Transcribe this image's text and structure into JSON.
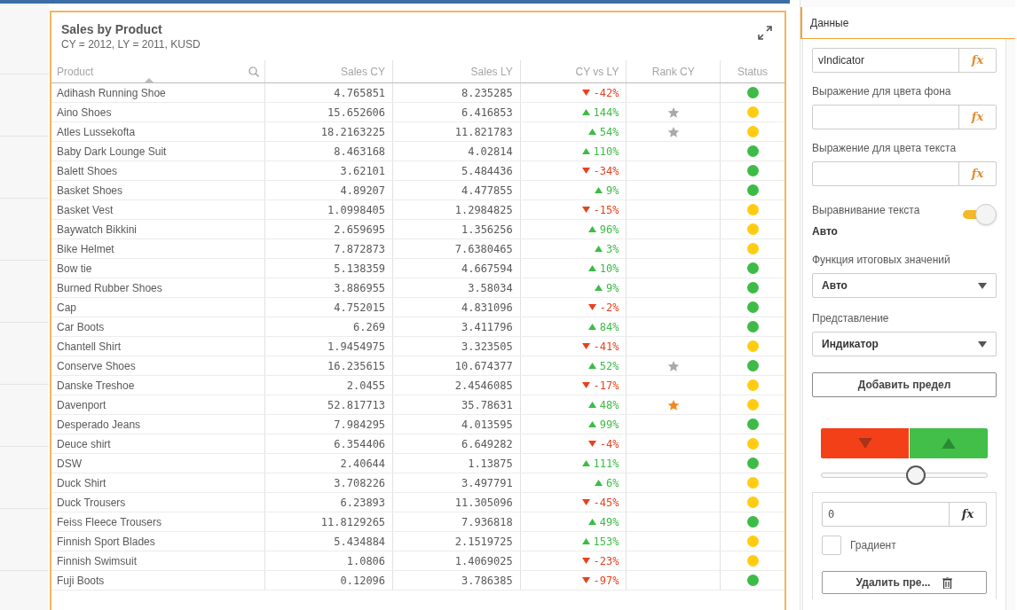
{
  "table": {
    "title": "Sales by Product",
    "subtitle": "CY = 2012, LY = 2011, KUSD",
    "columns": [
      "Product",
      "Sales CY",
      "Sales LY",
      "CY vs LY",
      "Rank CY",
      "Status"
    ],
    "rows": [
      {
        "product": "Adihash Running Shoe",
        "sales_cy": "4.765851",
        "sales_ly": "8.235285",
        "rising": false,
        "change": "-42%",
        "color": "#3dbb46"
      },
      {
        "product": "Aino Shoes",
        "sales_cy": "15.652606",
        "sales_ly": "6.416853",
        "rising": true,
        "change": "144%",
        "star": {
          "color": "#a9a9a9"
        },
        "color": "#ffcc11"
      },
      {
        "product": "Atles Lussekofta",
        "sales_cy": "18.2163225",
        "sales_ly": "11.821783",
        "rising": true,
        "change": "54%",
        "star": {
          "color": "#a9a9a9"
        },
        "color": "#ffcc11"
      },
      {
        "product": "Baby Dark Lounge Suit",
        "sales_cy": "8.463168",
        "sales_ly": "4.02814",
        "rising": true,
        "change": "110%",
        "color": "#3dbb46"
      },
      {
        "product": "Balett Shoes",
        "sales_cy": "3.62101",
        "sales_ly": "5.484436",
        "rising": false,
        "change": "-34%",
        "color": "#3dbb46"
      },
      {
        "product": "Basket Shoes",
        "sales_cy": "4.89207",
        "sales_ly": "4.477855",
        "rising": true,
        "change": "9%",
        "color": "#3dbb46"
      },
      {
        "product": "Basket Vest",
        "sales_cy": "1.0998405",
        "sales_ly": "1.2984825",
        "rising": false,
        "change": "-15%",
        "color": "#ffcc11"
      },
      {
        "product": "Baywatch Bikkini",
        "sales_cy": "2.659695",
        "sales_ly": "1.356256",
        "rising": true,
        "change": "96%",
        "color": "#ffcc11"
      },
      {
        "product": "Bike Helmet",
        "sales_cy": "7.872873",
        "sales_ly": "7.6380465",
        "rising": true,
        "change": "3%",
        "color": "#ffcc11"
      },
      {
        "product": "Bow tie",
        "sales_cy": "5.138359",
        "sales_ly": "4.667594",
        "rising": true,
        "change": "10%",
        "color": "#3dbb46"
      },
      {
        "product": "Burned Rubber Shoes",
        "sales_cy": "3.886955",
        "sales_ly": "3.58034",
        "rising": true,
        "change": "9%",
        "color": "#3dbb46"
      },
      {
        "product": "Cap",
        "sales_cy": "4.752015",
        "sales_ly": "4.831096",
        "rising": false,
        "change": "-2%",
        "color": "#3dbb46"
      },
      {
        "product": "Car Boots",
        "sales_cy": "6.269",
        "sales_ly": "3.411796",
        "rising": true,
        "change": "84%",
        "color": "#3dbb46"
      },
      {
        "product": "Chantell Shirt",
        "sales_cy": "1.9454975",
        "sales_ly": "3.323505",
        "rising": false,
        "change": "-41%",
        "color": "#ffcc11"
      },
      {
        "product": "Conserve Shoes",
        "sales_cy": "16.235615",
        "sales_ly": "10.674377",
        "rising": true,
        "change": "52%",
        "star": {
          "color": "#a9a9a9"
        },
        "color": "#3dbb46"
      },
      {
        "product": "Danske Treshoe",
        "sales_cy": "2.0455",
        "sales_ly": "2.4546085",
        "rising": false,
        "change": "-17%",
        "color": "#ffcc11"
      },
      {
        "product": "Davenport",
        "sales_cy": "52.817713",
        "sales_ly": "35.78631",
        "rising": true,
        "change": "48%",
        "star": {
          "color": "#f28b1b"
        },
        "color": "#ffcc11"
      },
      {
        "product": "Desperado Jeans",
        "sales_cy": "7.984295",
        "sales_ly": "4.013595",
        "rising": true,
        "change": "99%",
        "color": "#3dbb46"
      },
      {
        "product": "Deuce shirt",
        "sales_cy": "6.354406",
        "sales_ly": "6.649282",
        "rising": false,
        "change": "-4%",
        "color": "#ffcc11"
      },
      {
        "product": "DSW",
        "sales_cy": "2.40644",
        "sales_ly": "1.13875",
        "rising": true,
        "change": "111%",
        "color": "#3dbb46"
      },
      {
        "product": "Duck Shirt",
        "sales_cy": "3.708226",
        "sales_ly": "3.497791",
        "rising": true,
        "change": "6%",
        "color": "#ffcc11"
      },
      {
        "product": "Duck Trousers",
        "sales_cy": "6.23893",
        "sales_ly": "11.305096",
        "rising": false,
        "change": "-45%",
        "color": "#ffcc11"
      },
      {
        "product": "Feiss Fleece Trousers",
        "sales_cy": "11.8129265",
        "sales_ly": "7.936818",
        "rising": true,
        "change": "49%",
        "color": "#3dbb46"
      },
      {
        "product": "Finnish Sport Blades",
        "sales_cy": "5.434884",
        "sales_ly": "2.1519725",
        "rising": true,
        "change": "153%",
        "color": "#ffcc11"
      },
      {
        "product": "Finnish Swimsuit",
        "sales_cy": "1.0806",
        "sales_ly": "1.4069025",
        "rising": false,
        "change": "-23%",
        "color": "#ffcc11"
      },
      {
        "product": "Fuji Boots",
        "sales_cy": "0.12096",
        "sales_ly": "3.786385",
        "rising": false,
        "change": "-97%",
        "color": "#3dbb46"
      }
    ]
  },
  "panel": {
    "tab": "Данные",
    "expression_field": {
      "value": "vIndicator",
      "button": "fx"
    },
    "fields": [
      {
        "label": "Выражение для цвета фона",
        "button": "fx"
      },
      {
        "label": "Выражение для цвета текста",
        "button": "fx"
      }
    ],
    "alignment": {
      "label": "Выравнивание текста",
      "value": "Авто",
      "on": true
    },
    "dropdowns": [
      {
        "label": "Функция итоговых значений",
        "value": "Авто"
      },
      {
        "label": "Представление",
        "value": "Индикатор"
      }
    ],
    "add_limit": "Добавить предел",
    "limit_slider": {
      "level": 0.57
    },
    "limit_value": {
      "value": "0",
      "button": "fx"
    },
    "gradient": {
      "label": "Градиент",
      "checked": false
    },
    "delete_limit": "Удалить пре..."
  }
}
